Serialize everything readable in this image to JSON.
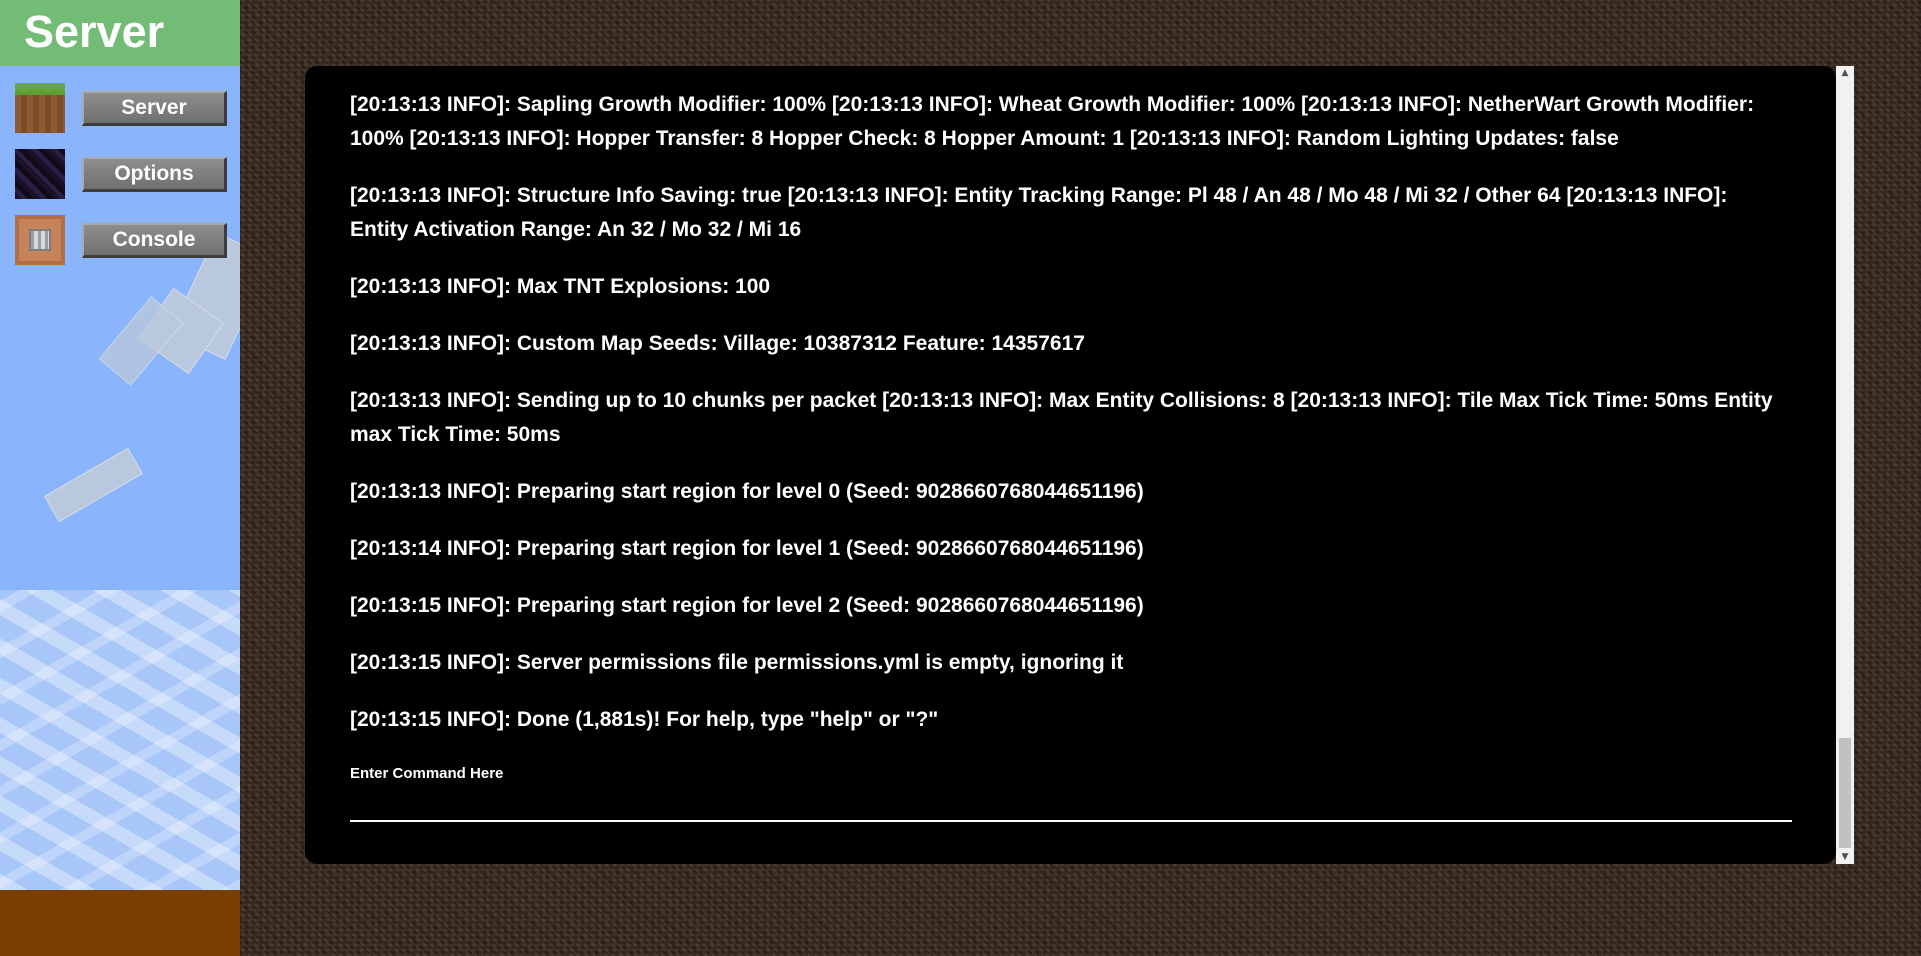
{
  "sidebar": {
    "title": "Server",
    "items": [
      {
        "label": "Server",
        "icon": "grass-block-icon"
      },
      {
        "label": "Options",
        "icon": "obsidian-block-icon"
      },
      {
        "label": "Console",
        "icon": "command-block-icon"
      }
    ]
  },
  "console": {
    "lines": [
      "[20:13:13 INFO]: Sapling Growth Modifier: 100% [20:13:13 INFO]: Wheat Growth Modifier: 100% [20:13:13 INFO]: NetherWart Growth Modifier: 100% [20:13:13 INFO]: Hopper Transfer: 8 Hopper Check: 8 Hopper Amount: 1 [20:13:13 INFO]: Random Lighting Updates: false",
      "[20:13:13 INFO]: Structure Info Saving: true [20:13:13 INFO]: Entity Tracking Range: Pl 48 / An 48 / Mo 48 / Mi 32 / Other 64 [20:13:13 INFO]: Entity Activation Range: An 32 / Mo 32 / Mi 16",
      "[20:13:13 INFO]: Max TNT Explosions: 100",
      "[20:13:13 INFO]: Custom Map Seeds: Village: 10387312 Feature: 14357617",
      "[20:13:13 INFO]: Sending up to 10 chunks per packet [20:13:13 INFO]: Max Entity Collisions: 8 [20:13:13 INFO]: Tile Max Tick Time: 50ms Entity max Tick Time: 50ms",
      "[20:13:13 INFO]: Preparing start region for level 0 (Seed: 9028660768044651196)",
      "[20:13:14 INFO]: Preparing start region for level 1 (Seed: 9028660768044651196)",
      "[20:13:15 INFO]: Preparing start region for level 2 (Seed: 9028660768044651196)",
      "[20:13:15 INFO]: Server permissions file permissions.yml is empty, ignoring it",
      "[20:13:15 INFO]: Done (1,881s)! For help, type \"help\" or \"?\""
    ],
    "command_label": "Enter Command Here",
    "command_value": ""
  },
  "colors": {
    "sidebar_header": "#73bc75",
    "sidebar_sky": "#8ab4fb",
    "sidebar_ground": "#7a3d02",
    "console_bg": "#000000",
    "console_text": "#ffffff"
  }
}
